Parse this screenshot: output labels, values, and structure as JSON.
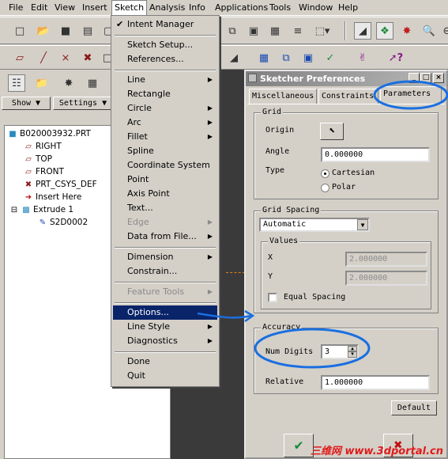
{
  "menubar": {
    "items": [
      "File",
      "Edit",
      "View",
      "Insert",
      "Sketch",
      "Analysis",
      "Info",
      "Applications",
      "Tools",
      "Window",
      "Help"
    ]
  },
  "left_panel": {
    "show_label": "Show",
    "settings_label": "Settings"
  },
  "tree": {
    "items": [
      "B020003932.PRT",
      "RIGHT",
      "TOP",
      "FRONT",
      "PRT_CSYS_DEF",
      "Insert Here",
      "Extrude 1",
      "S2D0002"
    ]
  },
  "sketch_menu": {
    "intent_manager": "Intent Manager",
    "sketch_setup": "Sketch Setup...",
    "references": "References...",
    "line": "Line",
    "rectangle": "Rectangle",
    "circle": "Circle",
    "arc": "Arc",
    "fillet": "Fillet",
    "spline": "Spline",
    "coordinate_system": "Coordinate System",
    "point": "Point",
    "axis_point": "Axis Point",
    "text": "Text...",
    "edge": "Edge",
    "data_from_file": "Data from File...",
    "dimension": "Dimension",
    "constrain": "Constrain...",
    "feature_tools": "Feature Tools",
    "options": "Options...",
    "line_style": "Line Style",
    "diagnostics": "Diagnostics",
    "done": "Done",
    "quit": "Quit"
  },
  "dialog": {
    "title": "Sketcher Preferences",
    "tabs": [
      "Miscellaneous",
      "Constraints",
      "Parameters"
    ],
    "grid": {
      "title": "Grid",
      "origin_label": "Origin",
      "angle_label": "Angle",
      "angle_value": "0.000000",
      "type_label": "Type",
      "type_cartesian": "Cartesian",
      "type_polar": "Polar"
    },
    "grid_spacing": {
      "title": "Grid Spacing",
      "mode": "Automatic",
      "values_title": "Values",
      "x_label": "X",
      "x_value": "2.000000",
      "y_label": "Y",
      "y_value": "2.000000",
      "equal_spacing": "Equal Spacing"
    },
    "accuracy": {
      "title": "Accuracy",
      "num_digits_label": "Num Digits",
      "num_digits_value": "3",
      "relative_label": "Relative",
      "relative_value": "1.000000"
    },
    "default_button": "Default"
  },
  "watermark": "三维网 www.3dportal.cn",
  "colors": {
    "annotation_blue": "#1a6fe0",
    "menu_highlight": "#0a246a",
    "watermark_red": "#e01b1b"
  }
}
